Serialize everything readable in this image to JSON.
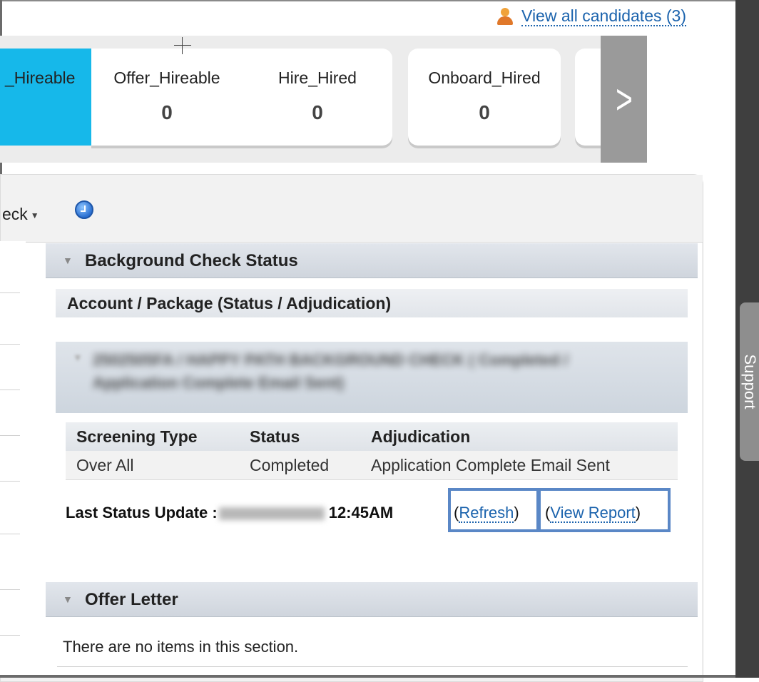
{
  "header": {
    "view_all_label": "View all candidates (3)"
  },
  "stages": [
    {
      "label": "_Hireable",
      "count": ""
    },
    {
      "label": "Offer_Hireable",
      "count": "0"
    },
    {
      "label": "Hire_Hired",
      "count": "0"
    },
    {
      "label": "Onboard_Hired",
      "count": "0"
    }
  ],
  "stage_nav": {
    "next_glyph": ">"
  },
  "toolbar": {
    "menu_label": "eck",
    "caret": "▼"
  },
  "support_tab_label": "Support",
  "background_check": {
    "title": "Background Check Status",
    "toggle_glyph": "▼",
    "subheader": "Account / Package (Status / Adjudication)",
    "package_text": "2502505FA / HAPPY PATH BACKGROUND CHECK ( Completed / Application Complete Email Sent)",
    "table": {
      "headers": [
        "Screening Type",
        "Status",
        "Adjudication"
      ],
      "rows": [
        [
          "Over All",
          "Completed",
          "Application Complete Email Sent"
        ]
      ]
    },
    "last_update_label": "Last Status Update :",
    "last_update_time": "12:45AM",
    "refresh_label": "Refresh",
    "view_report_label": "View Report"
  },
  "offer_letter": {
    "title": "Offer Letter",
    "toggle_glyph": "▼",
    "empty_message": "There are no items in this section."
  }
}
